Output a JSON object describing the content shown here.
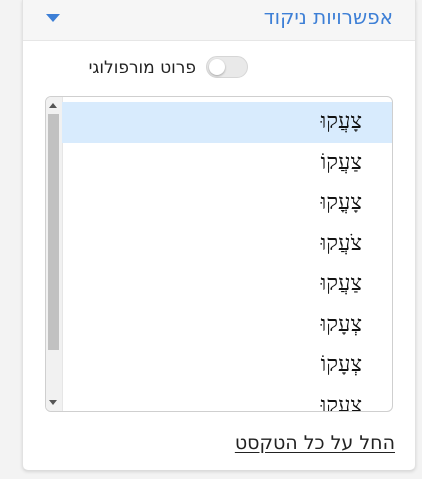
{
  "panel": {
    "title": "אפשרויות ניקוד",
    "collapse_icon": "caret-down-icon",
    "accent_color": "#3d7fd6"
  },
  "toggle": {
    "label": "פרוט מורפולוגי",
    "state": "off"
  },
  "options": {
    "selected_index": 0,
    "items": [
      "צָעֲקוּ",
      "צַעֲקוֹ",
      "צָעֳקוּ",
      "צֹעֲקוּ",
      "צַעֲקוּ",
      "צְעָקוּ",
      "צְעָקוֹ",
      "צִעֲקוּ"
    ],
    "selection_color": "#d8ebfd"
  },
  "apply_link": "החל על כל הטקסט"
}
